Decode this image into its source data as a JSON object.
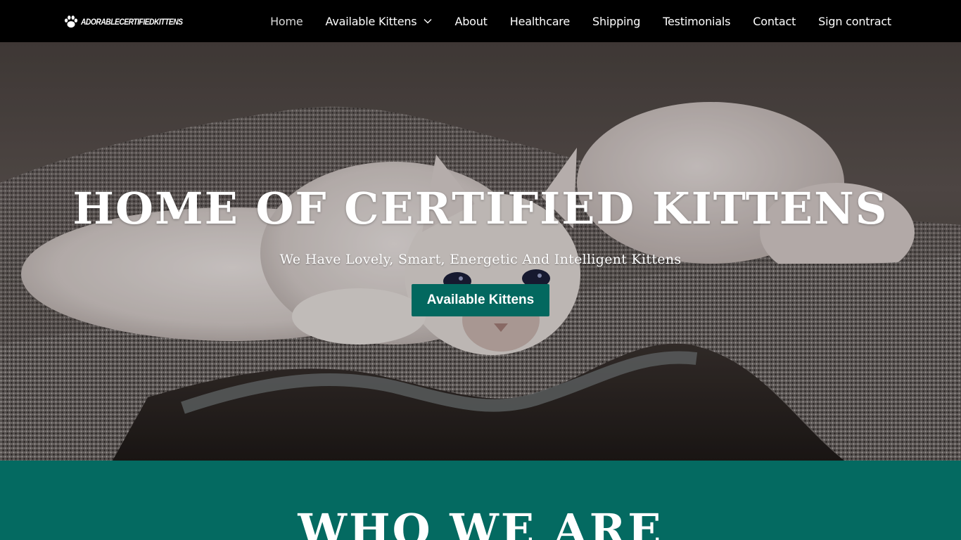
{
  "header": {
    "logo_text": "ADORABLECERTIFIEDKITTENS",
    "nav": [
      {
        "label": "Home",
        "active": true
      },
      {
        "label": "Available Kittens",
        "has_dropdown": true
      },
      {
        "label": "About"
      },
      {
        "label": "Healthcare"
      },
      {
        "label": "Shipping"
      },
      {
        "label": "Testimonials"
      },
      {
        "label": "Contact"
      },
      {
        "label": "Sign contract"
      }
    ]
  },
  "hero": {
    "title": "HOME OF CERTIFIED KITTENS",
    "subtitle": "We Have Lovely, Smart, Energetic And Intelligent Kittens",
    "button_label": "Available Kittens",
    "image": "kittens-on-blanket-photo"
  },
  "section": {
    "title": "WHO WE ARE"
  },
  "colors": {
    "header_bg": "#000000",
    "accent": "#03685f",
    "section_bg": "#046a61",
    "text": "#ffffff"
  },
  "icons": [
    "paw-icon",
    "chevron-down-icon"
  ]
}
